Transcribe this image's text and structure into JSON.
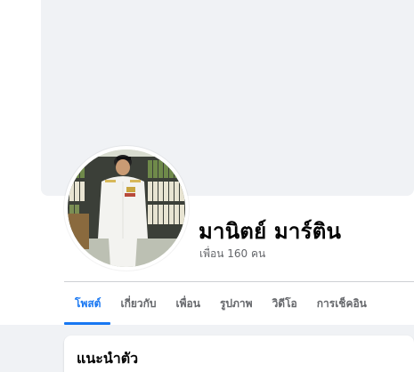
{
  "profile": {
    "name": "มานิตย์ มาร์ติน",
    "friends_label": "เพื่อน 160 คน"
  },
  "tabs": [
    {
      "label": "โพสต์",
      "active": true
    },
    {
      "label": "เกี่ยวกับ",
      "active": false
    },
    {
      "label": "เพื่อน",
      "active": false
    },
    {
      "label": "รูปภาพ",
      "active": false
    },
    {
      "label": "วิดีโอ",
      "active": false
    },
    {
      "label": "การเช็คอิน",
      "active": false
    }
  ],
  "intro": {
    "title": "แนะนำตัว"
  },
  "colors": {
    "accent": "#1877f2",
    "background": "#f0f2f5",
    "text_primary": "#050505",
    "text_secondary": "#65676b"
  }
}
